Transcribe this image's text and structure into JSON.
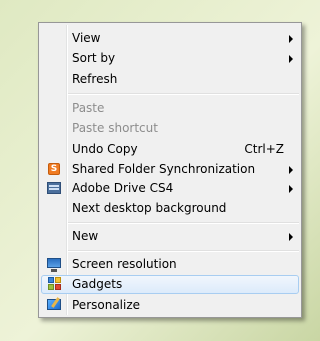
{
  "context_menu": {
    "items": [
      {
        "label": "View",
        "submenu": true
      },
      {
        "label": "Sort by",
        "submenu": true
      },
      {
        "label": "Refresh"
      },
      {
        "label": "Paste",
        "disabled": true
      },
      {
        "label": "Paste shortcut",
        "disabled": true
      },
      {
        "label": "Undo Copy",
        "shortcut": "Ctrl+Z"
      },
      {
        "label": "Shared Folder Synchronization",
        "icon": "shared-folder-sync-icon",
        "submenu": true
      },
      {
        "label": "Adobe Drive CS4",
        "icon": "adobe-drive-icon",
        "submenu": true
      },
      {
        "label": "Next desktop background"
      },
      {
        "label": "New",
        "submenu": true
      },
      {
        "label": "Screen resolution",
        "icon": "monitor-icon"
      },
      {
        "label": "Gadgets",
        "icon": "gadgets-icon",
        "highlighted": true
      },
      {
        "label": "Personalize",
        "icon": "personalize-icon"
      }
    ]
  },
  "colors": {
    "menu_background": "#f0f0f0",
    "highlight_border": "#a8cdf1",
    "disabled_text": "#8d8d8d"
  }
}
